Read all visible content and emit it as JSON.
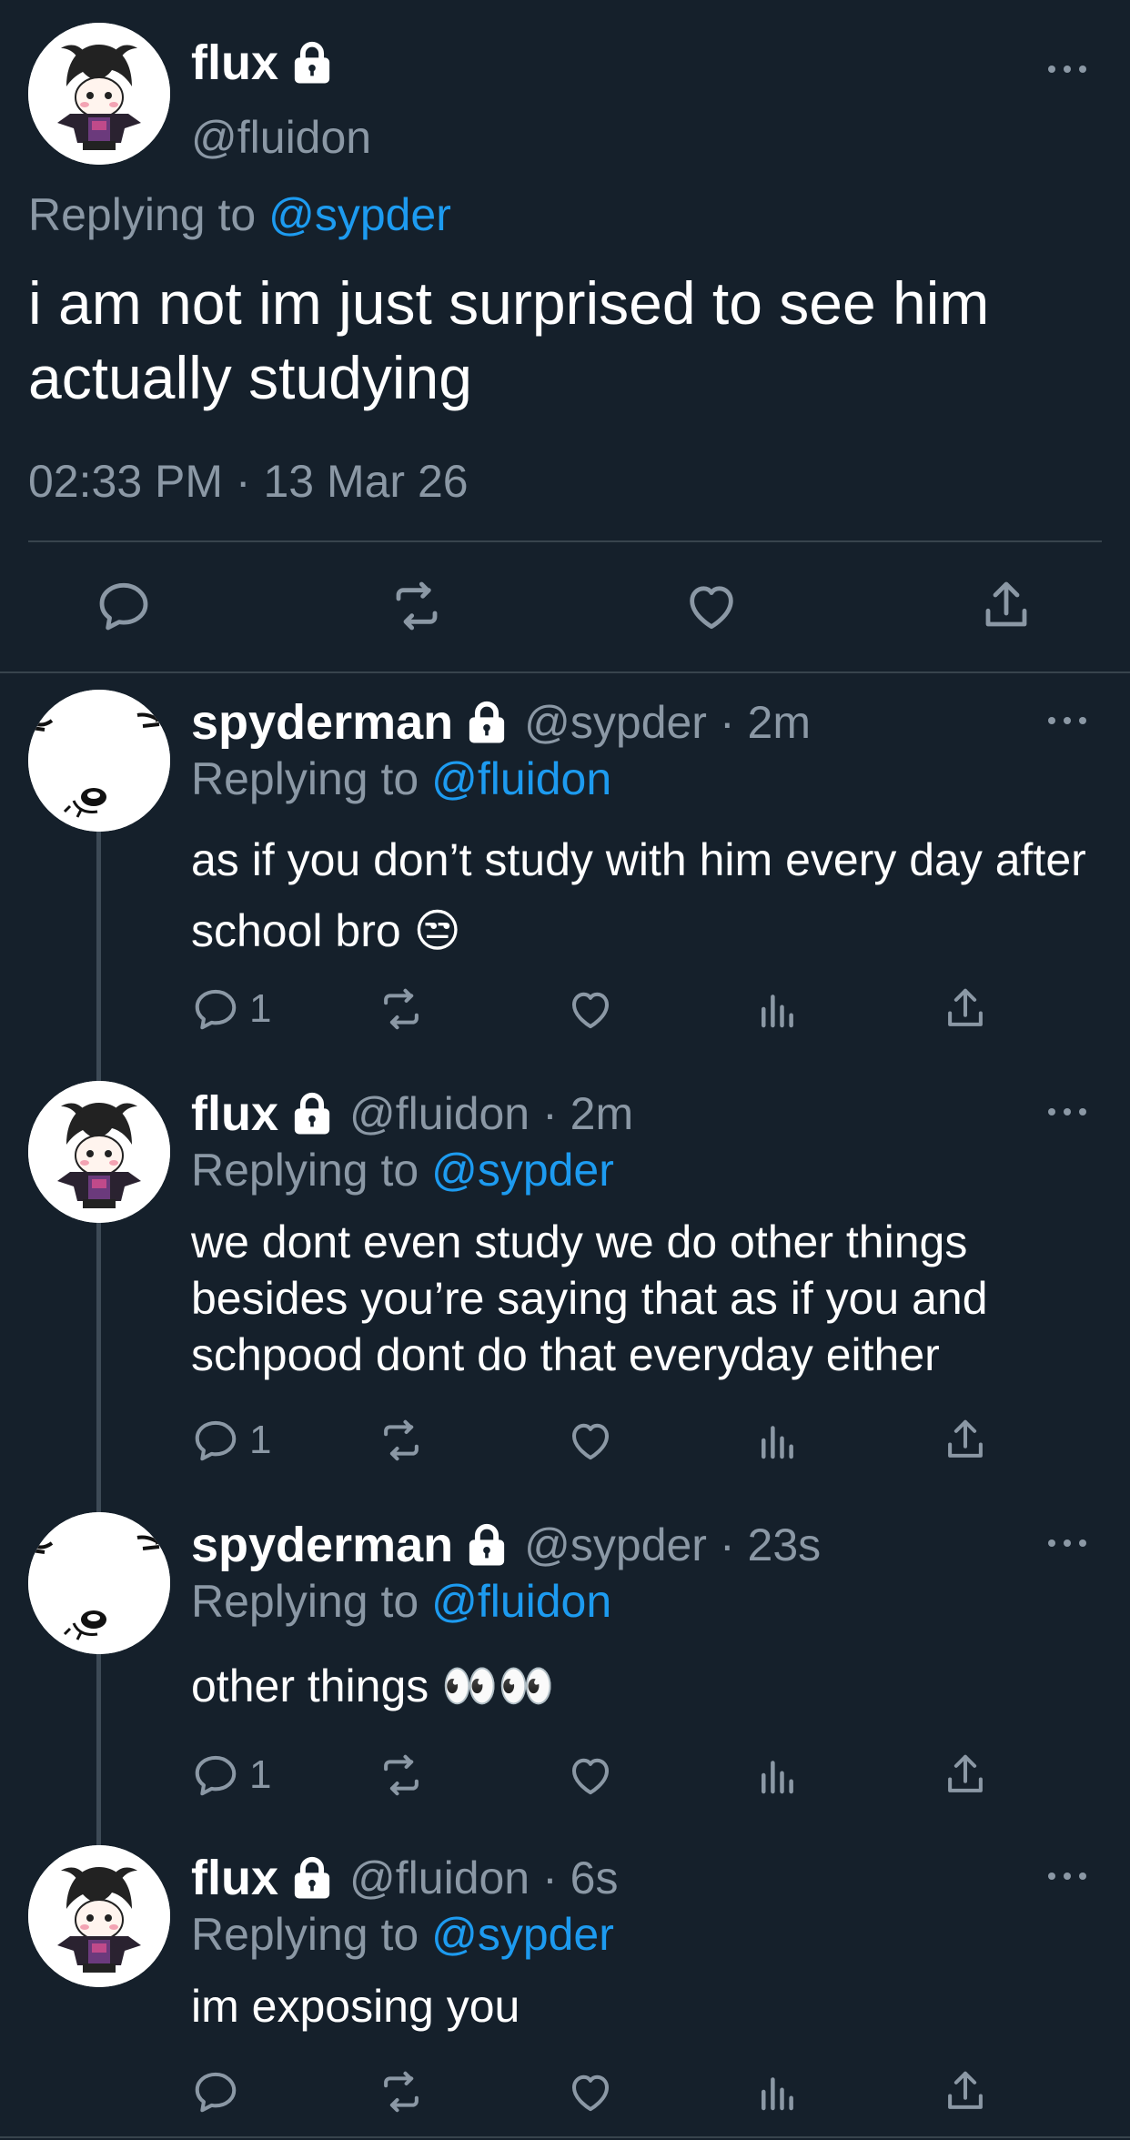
{
  "main_tweet": {
    "name": "flux",
    "handle": "@fluidon",
    "replying_prefix": "Replying to",
    "replying_handle": "@sypder",
    "text": "i am not im just surprised to see him actually studying",
    "timestamp": "02:33 PM · 13 Mar 26"
  },
  "replies": [
    {
      "name": "spyderman",
      "handle": "@sypder",
      "time": "· 2m",
      "replying_prefix": "Replying to",
      "replying_handle": "@fluidon",
      "text": "as if you don’t study with him every day after school bro 😒",
      "reply_count": "1"
    },
    {
      "name": "flux",
      "handle": "@fluidon",
      "time": "· 2m",
      "replying_prefix": "Replying to",
      "replying_handle": "@sypder",
      "text": "we dont even study we do other things besides you’re saying that as if you and schpood dont do that everyday either",
      "reply_count": "1"
    },
    {
      "name": "spyderman",
      "handle": "@sypder",
      "time": "· 23s",
      "replying_prefix": "Replying to",
      "replying_handle": "@fluidon",
      "text": "other things 👀👀",
      "reply_count": "1"
    },
    {
      "name": "flux",
      "handle": "@fluidon",
      "time": "· 6s",
      "replying_prefix": "Replying to",
      "replying_handle": "@sypder",
      "text": "im exposing you",
      "reply_count": ""
    }
  ],
  "icons": {
    "reply": "reply-bubble-icon",
    "retweet": "retweet-icon",
    "like": "heart-icon",
    "views": "analytics-icon",
    "share": "share-icon",
    "protected": "lock-icon",
    "more": "more-dots-icon"
  },
  "colors": {
    "background": "#15202b",
    "muted": "#8b98a5",
    "link": "#1d9bf0",
    "divider": "#38444d"
  }
}
